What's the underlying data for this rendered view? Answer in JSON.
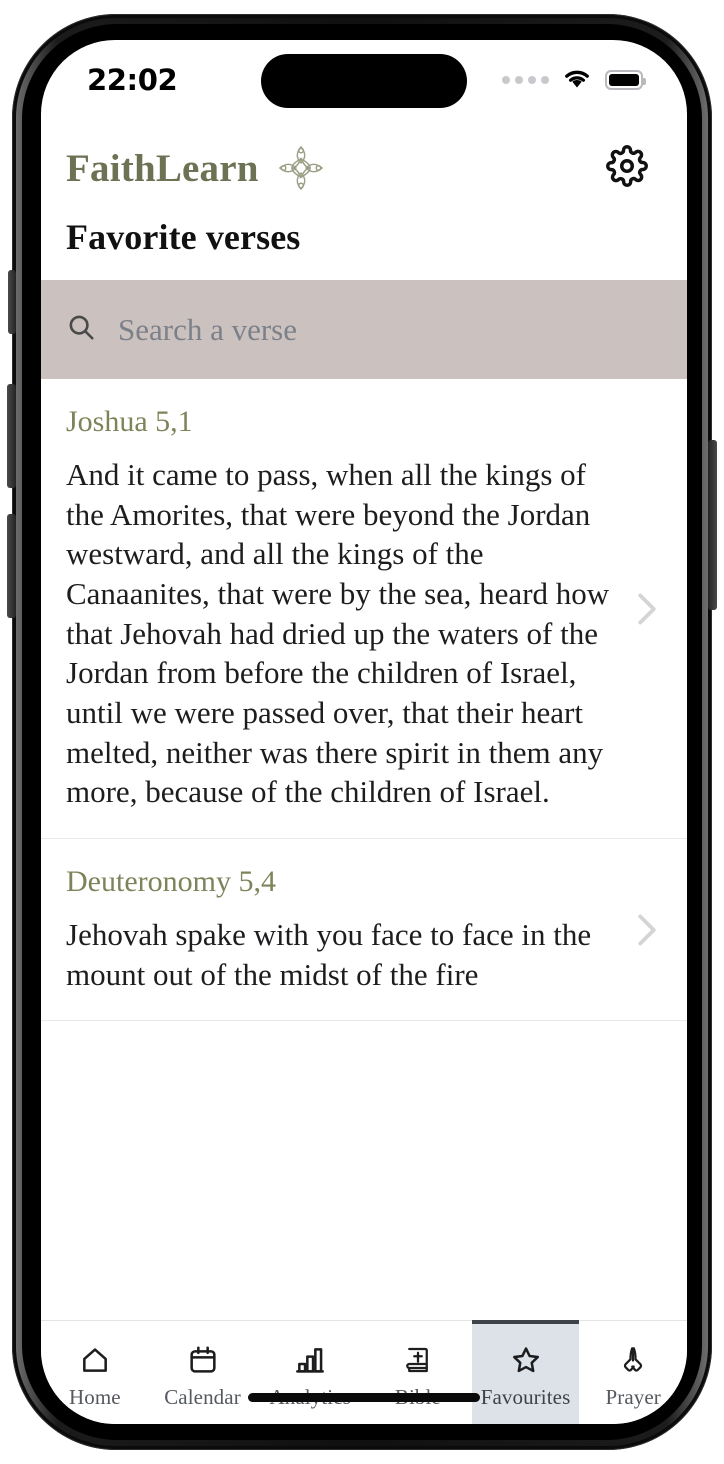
{
  "status_bar": {
    "time": "22:02",
    "signal_icon": "signal-dots-icon",
    "wifi_icon": "wifi-icon",
    "battery_icon": "battery-full-icon"
  },
  "header": {
    "brand": "FaithLearn",
    "ornament_icon": "floral-ornament-icon",
    "settings_icon": "gear-icon",
    "brand_color": "#6c7253"
  },
  "page": {
    "title": "Favorite verses"
  },
  "search": {
    "placeholder": "Search a verse",
    "icon": "search-icon",
    "background_color": "#cbc2c0",
    "value": ""
  },
  "verses": [
    {
      "reference": "Joshua 5,1",
      "text": "And it came to pass, when all the kings of the Amorites, that were beyond the Jordan westward, and all the kings of the Canaanites, that were by the sea, heard how that Jehovah had dried up the waters of the Jordan from before the children of Israel, until we were passed over, that their heart melted, neither was there spirit in them any more, because of the children of Israel.",
      "chevron_icon": "chevron-right-icon"
    },
    {
      "reference": "Deuteronomy 5,4",
      "text": "Jehovah spake with you face to face in the mount out of the midst of the fire",
      "chevron_icon": "chevron-right-icon"
    }
  ],
  "tabbar": {
    "active_index": 4,
    "active_background": "#dde2e8",
    "items": [
      {
        "label": "Home",
        "icon": "home-icon"
      },
      {
        "label": "Calendar",
        "icon": "calendar-icon"
      },
      {
        "label": "Analytics",
        "icon": "bar-chart-icon"
      },
      {
        "label": "Bible",
        "icon": "bible-book-icon"
      },
      {
        "label": "Favourites",
        "icon": "star-icon"
      },
      {
        "label": "Prayer",
        "icon": "praying-hands-icon"
      }
    ]
  },
  "system": {
    "home_indicator": "home-indicator"
  }
}
